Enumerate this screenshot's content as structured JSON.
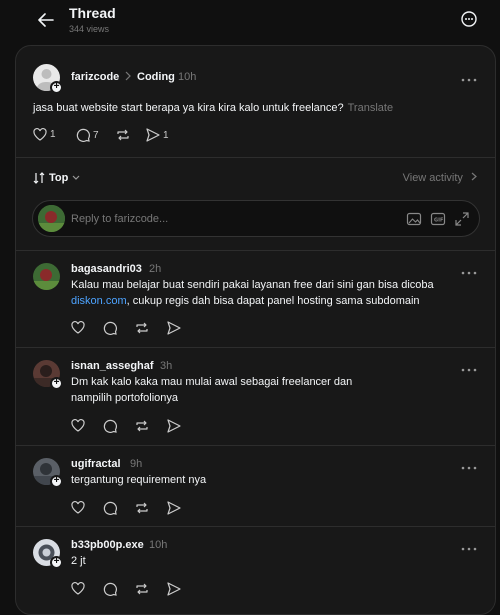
{
  "header": {
    "title": "Thread",
    "views": "344 views"
  },
  "post": {
    "username": "farizcode",
    "separator": ">",
    "topic": "Coding",
    "time": "10h",
    "text": "jasa buat website start berapa ya kira kira kalo untuk freelance?",
    "translate": "Translate",
    "likes": "1",
    "comments": "7",
    "shares": "1"
  },
  "sort": {
    "label": "Top",
    "view_activity": "View activity"
  },
  "reply": {
    "placeholder": "Reply to farizcode..."
  },
  "comments": [
    {
      "username": "bagasandri03",
      "time": "2h",
      "text_before": "Kalau mau belajar buat sendiri pakai layanan free dari sini gan bisa dicoba",
      "link": "diskon.com",
      "text_after": ", cukup regis dah bisa dapat panel hosting sama subdomain"
    },
    {
      "username": "isnan_asseghaf",
      "time": "3h",
      "text": "Dm kak kalo kaka mau mulai awal sebagai freelancer dan nampilih portofolionya"
    },
    {
      "username": "ugifractal",
      "time": "9h",
      "text": "tergantung requirement nya"
    },
    {
      "username": "b33pb00p.exe",
      "time": "10h",
      "text": "2 jt"
    }
  ],
  "colors": {
    "bg": "#101010",
    "card": "#181818",
    "text": "#f3f5f7",
    "muted": "#777777",
    "link": "#4da3ff"
  }
}
